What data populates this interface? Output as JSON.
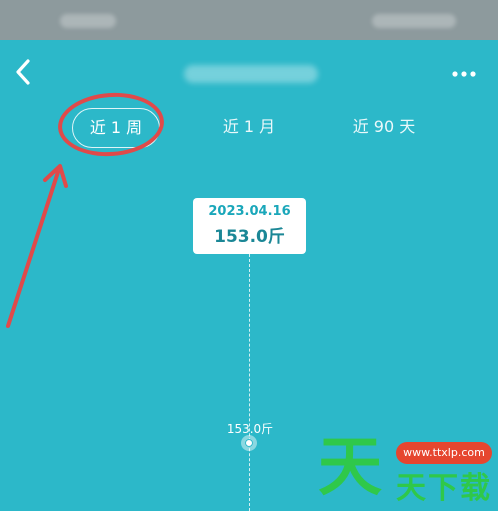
{
  "tabs": [
    {
      "label": "近 1 周",
      "active": true
    },
    {
      "label": "近 1 月",
      "active": false
    },
    {
      "label": "近 90 天",
      "active": false
    }
  ],
  "tooltip": {
    "date": "2023.04.16",
    "weight": "153.0斤"
  },
  "chart_data": {
    "type": "line",
    "x": [
      "2023.04.16"
    ],
    "values": [
      153.0
    ],
    "point_labels": [
      "153.0斤"
    ]
  },
  "icons": {
    "back": "chevron-left-icon",
    "more": "more-dots-icon"
  },
  "watermark": {
    "big": "天",
    "url": "www.ttxlp.com",
    "small": "天下载"
  },
  "colors": {
    "background": "#2cb8c9",
    "annotation": "#e04a4a",
    "watermark_green": "#2fc84a"
  }
}
